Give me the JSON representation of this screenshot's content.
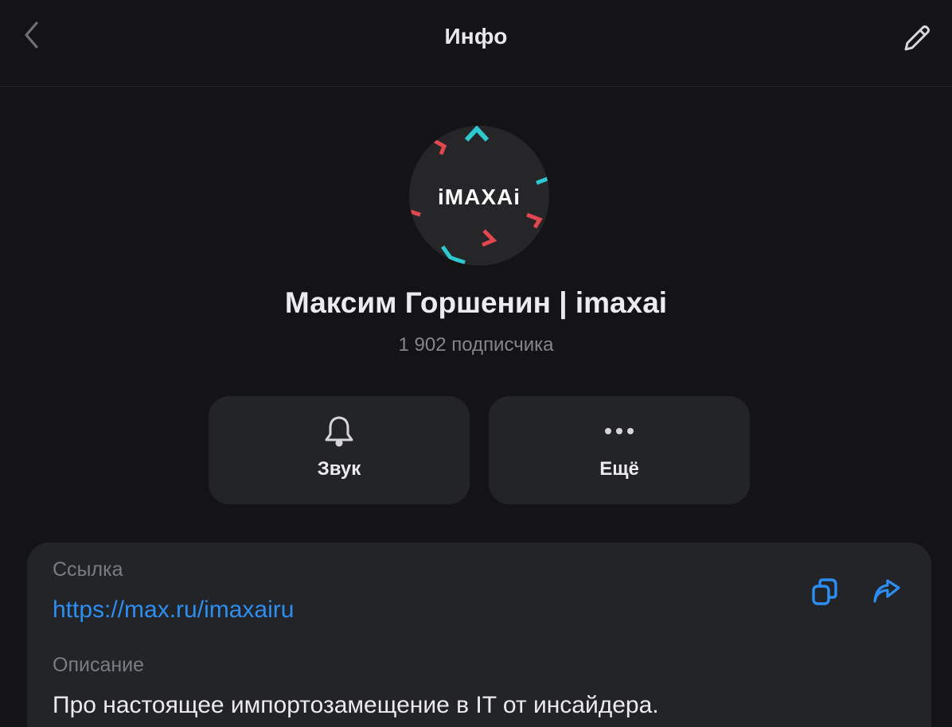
{
  "header": {
    "title": "Инфо",
    "back_icon": "chevron-left-icon",
    "edit_icon": "pencil-icon"
  },
  "profile": {
    "avatar_text": "iMAXAi",
    "name": "Максим Горшенин | imaxai",
    "subscribers": "1 902 подписчика"
  },
  "actions": [
    {
      "label": "Звук",
      "icon": "bell-icon"
    },
    {
      "label": "Ещё",
      "icon": "more-dots-icon"
    }
  ],
  "info": {
    "link_caption": "Ссылка",
    "link_value": "https://max.ru/imaxairu",
    "description_caption": "Описание",
    "description_value": "Про настоящее импортозамещение в IT от инсайдера.",
    "copy_icon": "copy-icon",
    "share_icon": "share-icon"
  },
  "colors": {
    "background": "#141417",
    "card": "#232428",
    "accent": "#2d8ef2",
    "muted_text": "#85868c",
    "logo_teal": "#2ec9cf",
    "logo_red": "#e2474f"
  }
}
